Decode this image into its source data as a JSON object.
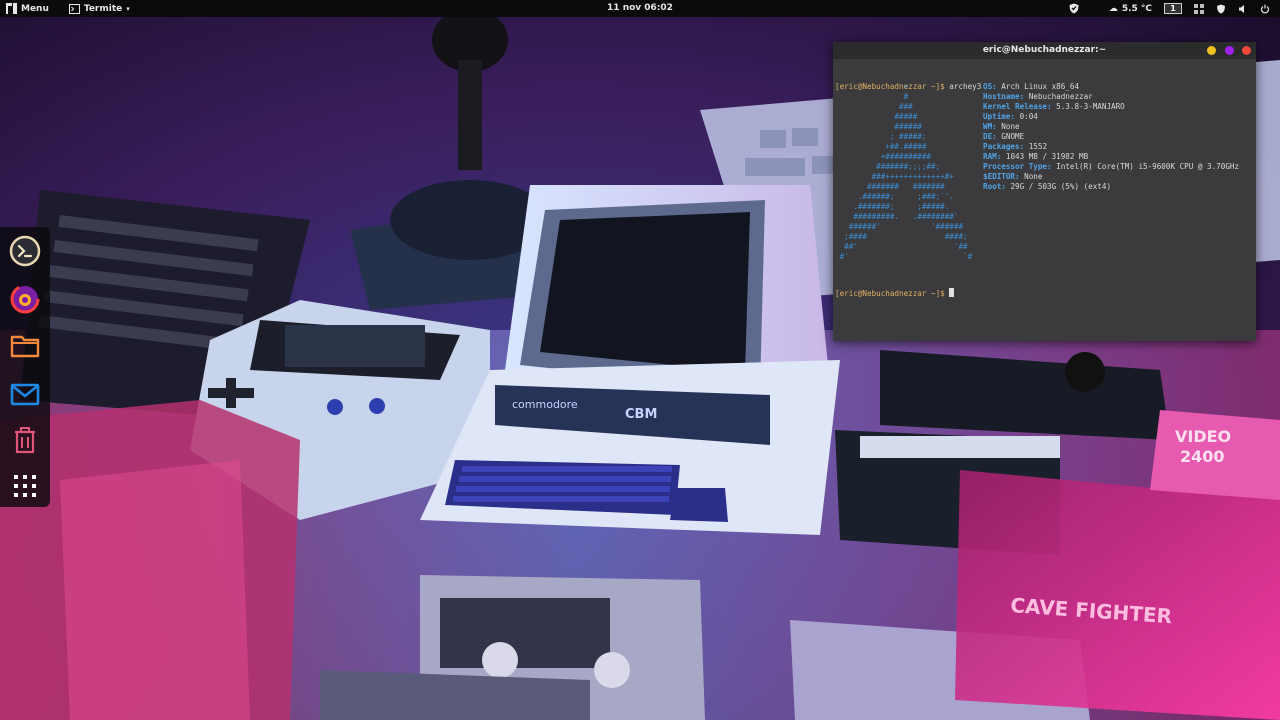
{
  "topbar": {
    "menu_label": "Menu",
    "app_label": "Termite",
    "datetime": "11 nov  06:02",
    "temperature": "5.5 °C",
    "workspace": "1"
  },
  "dock": {
    "items": [
      "terminal-icon",
      "firefox-icon",
      "folder-icon",
      "mail-icon",
      "trash-icon",
      "app-grid-icon"
    ]
  },
  "terminal": {
    "title": "eric@Nebuchadnezzar:~",
    "prompt": "[eric@Nebuchadnezzar ~]$ ",
    "command": "archey3",
    "logo_lines": [
      "               +",
      "               #",
      "              ###",
      "             #####",
      "             ######",
      "            ; #####;",
      "           +##.#####",
      "          +##########",
      "         #######;;;;##;",
      "        ###+++++++++++++#+",
      "       #######   #######",
      "     .######;     ;###;`'.",
      "    .#######;     ;#####.",
      "    #########.   .########`",
      "   ######'           '######",
      "  ;####                 ####;",
      "  ##'                     '##",
      " #'                         `#"
    ],
    "info": [
      {
        "key": "OS:",
        "value": "Arch Linux x86_64"
      },
      {
        "key": "Hostname:",
        "value": "Nebuchadnezzar"
      },
      {
        "key": "Kernel Release:",
        "value": "5.3.8-3-MANJARO"
      },
      {
        "key": "Uptime:",
        "value": "0:04"
      },
      {
        "key": "WM:",
        "value": "None"
      },
      {
        "key": "DE:",
        "value": "GNOME"
      },
      {
        "key": "Packages:",
        "value": "1552"
      },
      {
        "key": "RAM:",
        "value": "1043 MB / 31982 MB"
      },
      {
        "key": "Processor Type:",
        "value": "Intel(R) Core(TM) i5-9600K CPU @ 3.70GHz"
      },
      {
        "key": "$EDITOR:",
        "value": "None"
      },
      {
        "key": "Root:",
        "value": "29G / 503G (5%) (ext4)"
      }
    ]
  },
  "colors": {
    "close": "#f4473c",
    "maximize": "#a020f0",
    "minimize": "#f0c020"
  }
}
